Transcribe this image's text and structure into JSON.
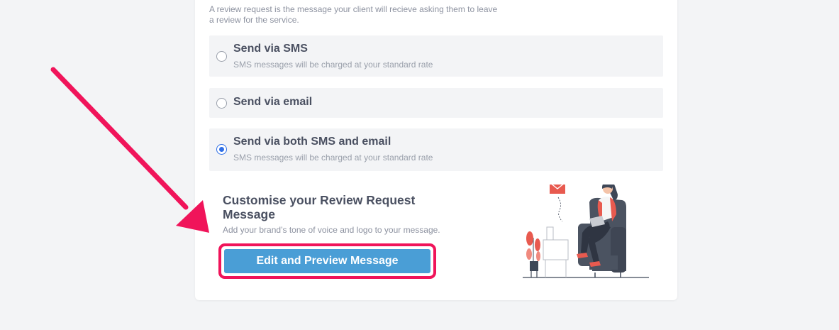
{
  "intro": {
    "text_line1": "A review request is the message your client will recieve asking them to leave",
    "text_line2": "a review for the service."
  },
  "options": [
    {
      "title": "Send via SMS",
      "subtitle": "SMS messages will be charged at your standard rate",
      "checked": false
    },
    {
      "title": "Send via email",
      "subtitle": "",
      "checked": false
    },
    {
      "title": "Send via both SMS and email",
      "subtitle": "SMS messages will be charged at your standard rate",
      "checked": true
    }
  ],
  "customise": {
    "title": "Customise your Review Request Message",
    "subtitle": "Add your brand’s tone of voice and logo to your message.",
    "button_label": "Edit and Preview Message"
  },
  "colors": {
    "accent_blue": "#4a9ed6",
    "radio_selected": "#2f6fe6",
    "highlight_pink": "#f0145a"
  }
}
